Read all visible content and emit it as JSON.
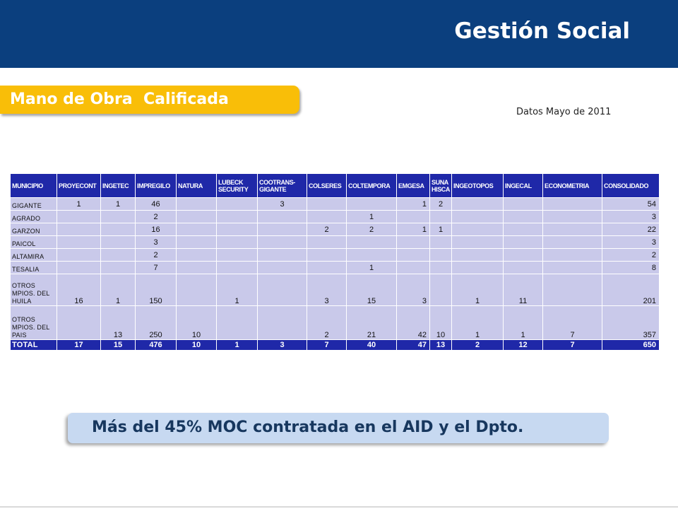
{
  "header": {
    "title": "Gestión Social"
  },
  "section": {
    "title": "Mano de Obra  Calificada",
    "date_note": "Datos Mayo de 2011"
  },
  "table": {
    "columns": [
      "MUNICIPIO",
      "PROYECONT",
      "INGETEC",
      "IMPREGILO",
      "NATURA",
      "LUBECK SECURITY",
      "COOTRANS-GIGANTE",
      "COLSERES",
      "COLTEMPORA",
      "EMGESA",
      "SUNA HISCA",
      "INGEOTOPOS",
      "INGECAL",
      "ECONOMETRIA",
      "CONSOLIDADO"
    ],
    "rows": [
      [
        "GIGANTE",
        "1",
        "1",
        "46",
        "",
        "",
        "3",
        "",
        "",
        "1",
        "2",
        "",
        "",
        "",
        "54"
      ],
      [
        "AGRADO",
        "",
        "",
        "2",
        "",
        "",
        "",
        "",
        "1",
        "",
        "",
        "",
        "",
        "",
        "3"
      ],
      [
        "GARZON",
        "",
        "",
        "16",
        "",
        "",
        "",
        "2",
        "2",
        "1",
        "1",
        "",
        "",
        "",
        "22"
      ],
      [
        "PAICOL",
        "",
        "",
        "3",
        "",
        "",
        "",
        "",
        "",
        "",
        "",
        "",
        "",
        "",
        "3"
      ],
      [
        "ALTAMIRA",
        "",
        "",
        "2",
        "",
        "",
        "",
        "",
        "",
        "",
        "",
        "",
        "",
        "",
        "2"
      ],
      [
        "TESALIA",
        "",
        "",
        "7",
        "",
        "",
        "",
        "",
        "1",
        "",
        "",
        "",
        "",
        "",
        "8"
      ],
      [
        "OTROS MPIOS. DEL HUILA",
        "16",
        "1",
        "150",
        "",
        "1",
        "",
        "3",
        "15",
        "3",
        "",
        "1",
        "11",
        "",
        "201"
      ],
      [
        "OTROS MPIOS. DEL PAIS",
        "",
        "13",
        "250",
        "10",
        "",
        "",
        "2",
        "21",
        "42",
        "10",
        "1",
        "1",
        "7",
        "357"
      ]
    ],
    "total": [
      "TOTAL",
      "17",
      "15",
      "476",
      "10",
      "1",
      "3",
      "7",
      "40",
      "47",
      "13",
      "2",
      "12",
      "7",
      "650"
    ]
  },
  "callout": {
    "text": "Más del 45% MOC contratada en el AID y el Dpto."
  },
  "colors": {
    "header_bg": "#0b3f7e",
    "accent_yellow": "#f9be08",
    "table_header_bg": "#1f28a8",
    "table_cell_bg": "#c9c9ea",
    "callout_bg": "#c7d9f1",
    "callout_text": "#17375e"
  }
}
